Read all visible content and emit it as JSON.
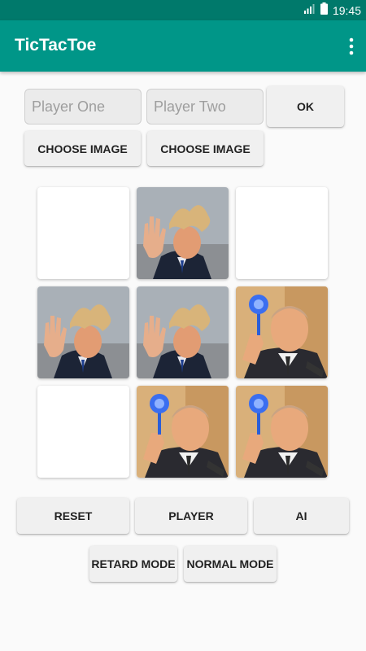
{
  "status_bar": {
    "time": "19:45",
    "icons": [
      "signal-icon",
      "battery-icon"
    ]
  },
  "app_bar": {
    "title": "TicTacToe",
    "menu_icon": "more-vert-icon"
  },
  "players": {
    "player_one_placeholder": "Player One",
    "player_two_placeholder": "Player Two",
    "ok_label": "OK",
    "choose_image_label_1": "CHOOSE IMAGE",
    "choose_image_label_2": "CHOOSE IMAGE"
  },
  "board": {
    "cells": [
      "empty",
      "trump",
      "empty",
      "trump",
      "trump",
      "putin",
      "empty",
      "putin",
      "putin"
    ]
  },
  "controls": {
    "reset_label": "RESET",
    "player_label": "PLAYER",
    "ai_label": "AI",
    "retard_mode_label": "RETARD MODE",
    "normal_mode_label": "NORMAL MODE"
  },
  "colors": {
    "status_bar": "#00796b",
    "app_bar": "#009688",
    "background": "#fafafa",
    "button": "#f0f0f0"
  }
}
